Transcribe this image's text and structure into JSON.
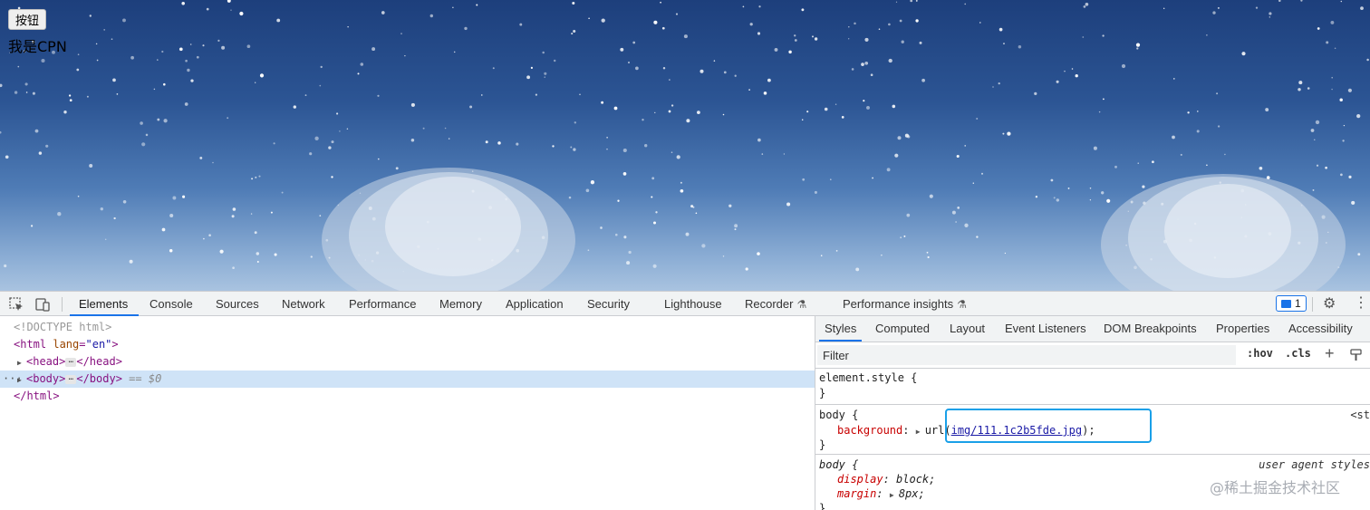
{
  "page": {
    "button_label": "按钮",
    "text": "我是CPN"
  },
  "devtools": {
    "tabs": [
      "Elements",
      "Console",
      "Sources",
      "Network",
      "Performance",
      "Memory",
      "Application",
      "Security",
      "Lighthouse",
      "Recorder",
      "Performance insights"
    ],
    "active_tab": "Elements",
    "issues_count": "1",
    "dom": {
      "doctype": "<!DOCTYPE html>",
      "html_open_tag": "<html",
      "html_attr_name": "lang",
      "html_attr_value": "\"en\"",
      "html_open_close": ">",
      "head_open": "<head>",
      "head_close": "</head>",
      "body_open": "<body>",
      "body_close": "</body>",
      "selected_marker": "== $0",
      "row_dots": "···",
      "html_close": "</html>"
    },
    "styles": {
      "subtabs": [
        "Styles",
        "Computed",
        "Layout",
        "Event Listeners",
        "DOM Breakpoints",
        "Properties",
        "Accessibility"
      ],
      "active_subtab": "Styles",
      "filter_placeholder": "Filter",
      "hov_label": ":hov",
      "cls_label": ".cls",
      "element_style_selector": "element.style {",
      "close_brace": "}",
      "rule1": {
        "selector": "body {",
        "source": "<st",
        "property": "background",
        "value_prefix": "url(",
        "value_link": "img/111.1c2b5fde.jpg",
        "value_suffix": ");"
      },
      "rule2": {
        "selector": "body {",
        "source": "user agent styles",
        "prop1": "display",
        "val1": "block;",
        "prop2": "margin",
        "val2": "8px;"
      }
    }
  },
  "colors": {
    "accent": "#1a73e8",
    "highlight_box": "#1aa0e8",
    "tag": "#881280",
    "property": "#c80000"
  },
  "watermark": "@稀土掘金技术社区"
}
